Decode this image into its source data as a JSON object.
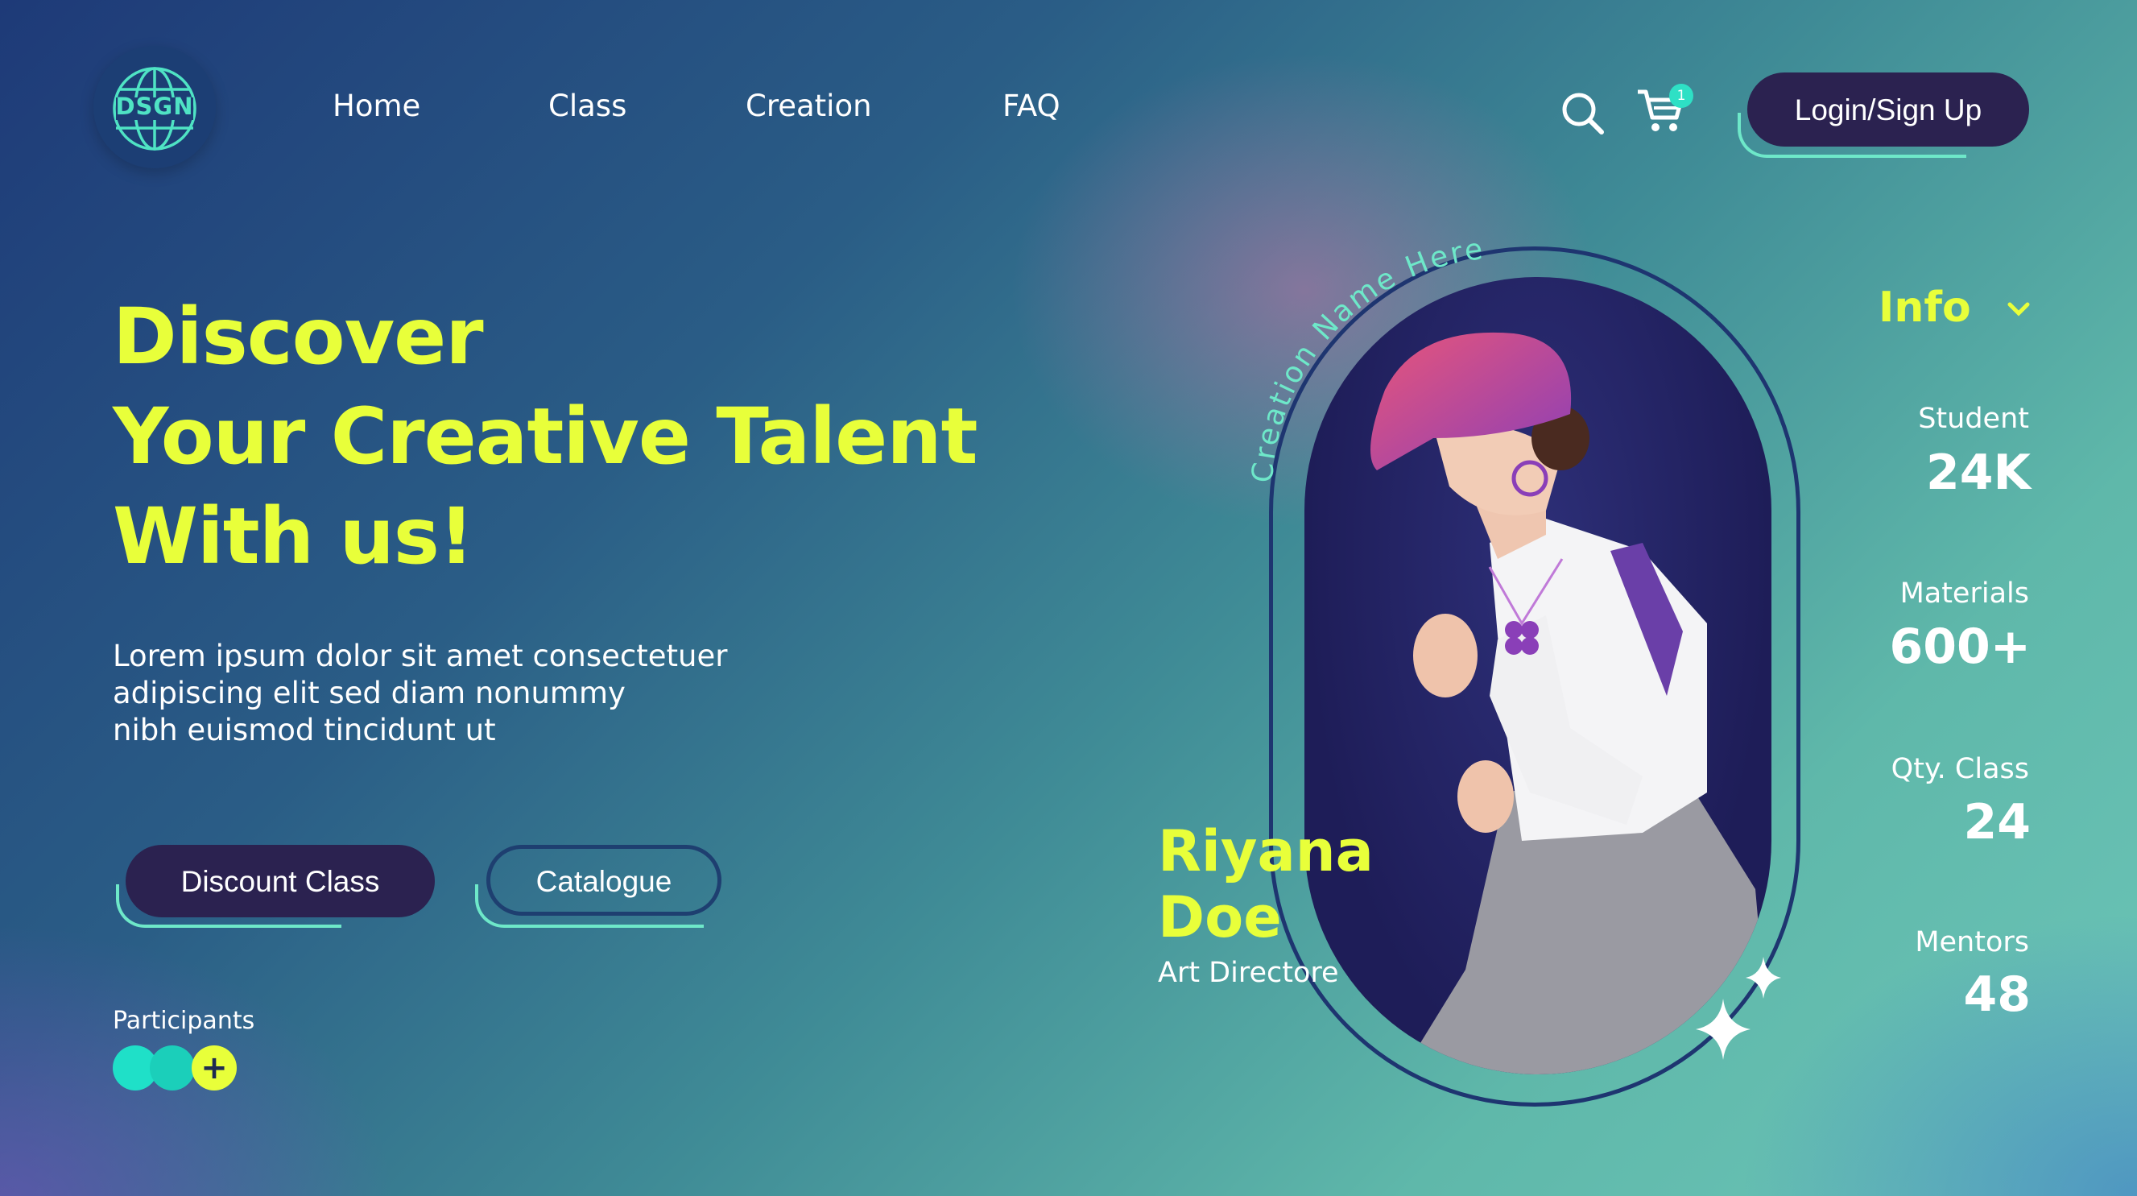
{
  "brand": {
    "logo_text": "DSGN"
  },
  "nav": {
    "items": [
      "Home",
      "Class",
      "Creation",
      "FAQ"
    ]
  },
  "header": {
    "cart_count": "1",
    "login_label": "Login/Sign Up"
  },
  "hero": {
    "line1": "Discover",
    "line2": "Your Creative Talent",
    "line3": "With us!",
    "description": [
      "Lorem ipsum dolor sit amet consectetuer",
      "adipiscing elit sed diam nonummy",
      "nibh euismod tincidunt ut"
    ],
    "discount_label": "Discount Class",
    "catalogue_label": "Catalogue",
    "participants_label": "Participants",
    "participants_more": "+"
  },
  "feature": {
    "creation_name": "Creation Name Here",
    "first_name": "Riyana",
    "last_name": "Doe",
    "role": "Art Directore"
  },
  "info": {
    "title": "Info",
    "stats": [
      {
        "label": "Student",
        "value": "24K"
      },
      {
        "label": "Materials",
        "value": "600+"
      },
      {
        "label": "Qty. Class",
        "value": "24"
      },
      {
        "label": "Mentors",
        "value": "48"
      }
    ]
  },
  "colors": {
    "accent_yellow": "#e8ff3a",
    "accent_mint": "#6ee8c9",
    "button_dark": "#2b2250",
    "frame_navy": "#1e3570"
  },
  "icons": [
    "globe-icon",
    "search-icon",
    "cart-icon",
    "chevron-down-icon",
    "sparkle-icon",
    "plus-icon"
  ]
}
